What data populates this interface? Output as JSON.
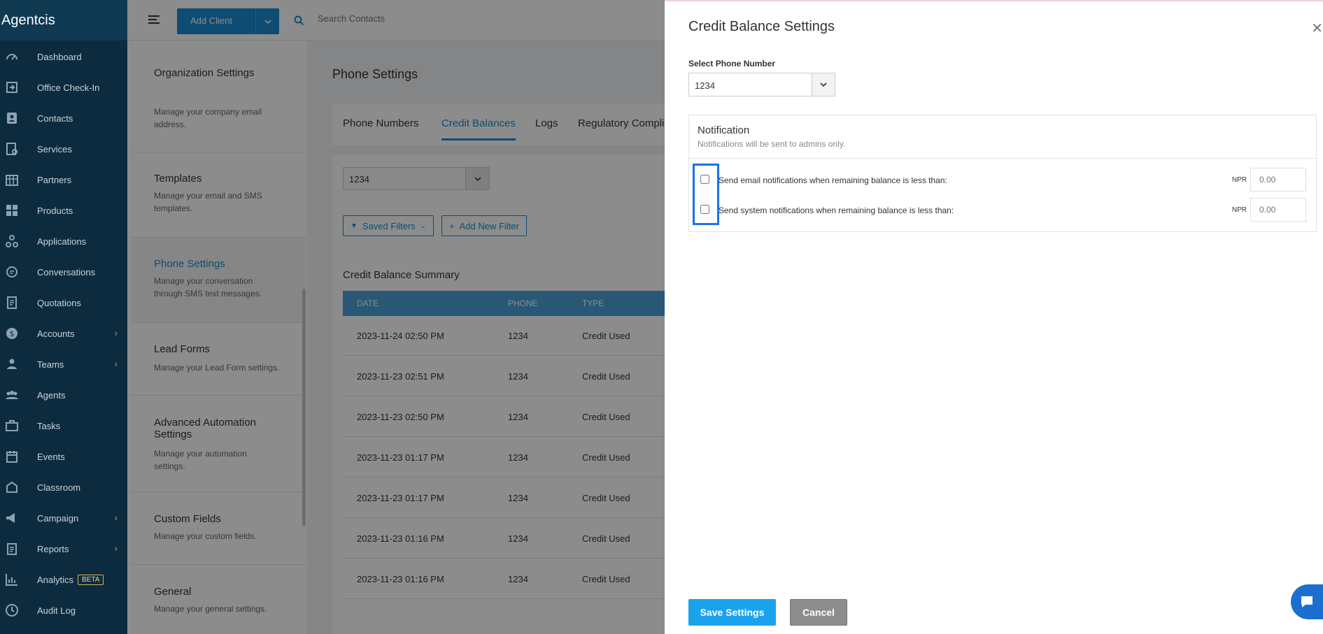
{
  "sidebar": {
    "brand": "Agentcis",
    "items": [
      {
        "label": "Dashboard",
        "icon": "dashboard-icon",
        "chevron": false
      },
      {
        "label": "Office Check-In",
        "icon": "check-in-icon",
        "chevron": false
      },
      {
        "label": "Contacts",
        "icon": "contacts-icon",
        "chevron": false
      },
      {
        "label": "Services",
        "icon": "services-icon",
        "chevron": false
      },
      {
        "label": "Partners",
        "icon": "partners-icon",
        "chevron": false
      },
      {
        "label": "Products",
        "icon": "products-icon",
        "chevron": false
      },
      {
        "label": "Applications",
        "icon": "applications-icon",
        "chevron": false
      },
      {
        "label": "Conversations",
        "icon": "conversations-icon",
        "chevron": false
      },
      {
        "label": "Quotations",
        "icon": "quotations-icon",
        "chevron": false
      },
      {
        "label": "Accounts",
        "icon": "accounts-icon",
        "chevron": true
      },
      {
        "label": "Teams",
        "icon": "teams-icon",
        "chevron": true
      },
      {
        "label": "Agents",
        "icon": "agents-icon",
        "chevron": false
      },
      {
        "label": "Tasks",
        "icon": "tasks-icon",
        "chevron": false
      },
      {
        "label": "Events",
        "icon": "events-icon",
        "chevron": false
      },
      {
        "label": "Classroom",
        "icon": "classroom-icon",
        "chevron": false
      },
      {
        "label": "Campaign",
        "icon": "campaign-icon",
        "chevron": true
      },
      {
        "label": "Reports",
        "icon": "reports-icon",
        "chevron": true
      },
      {
        "label": "Analytics",
        "icon": "analytics-icon",
        "chevron": false,
        "badge": "BETA"
      },
      {
        "label": "Audit Log",
        "icon": "audit-log-icon",
        "chevron": false
      }
    ]
  },
  "topbar": {
    "add_client_label": "Add Client",
    "search_placeholder": "Search Contacts"
  },
  "settings_list": {
    "items": [
      {
        "title": "Organization Settings",
        "desc": "Manage your company email address."
      },
      {
        "title": "Templates",
        "desc": "Manage your email and SMS templates."
      },
      {
        "title": "Phone Settings",
        "desc": "Manage your conversation through SMS text messages."
      },
      {
        "title": "Lead Forms",
        "desc": "Manage your Lead Form settings."
      },
      {
        "title": "Advanced Automation Settings",
        "desc": "Manage your automation settings."
      },
      {
        "title": "Custom Fields",
        "desc": "Manage your custom fields."
      },
      {
        "title": "General",
        "desc": "Manage your general settings."
      }
    ]
  },
  "main": {
    "title": "Phone Settings",
    "tabs": [
      "Phone Numbers",
      "Credit Balances",
      "Logs",
      "Regulatory Compli"
    ],
    "phone_select_value": "1234",
    "saved_filters_label": "Saved Filters",
    "add_filter_label": "Add New Filter",
    "summary_title": "Credit Balance Summary",
    "table": {
      "columns": [
        "DATE",
        "PHONE",
        "TYPE"
      ],
      "rows": [
        [
          "2023-11-24 02:50 PM",
          "1234",
          "Credit Used"
        ],
        [
          "2023-11-23 02:51 PM",
          "1234",
          "Credit Used"
        ],
        [
          "2023-11-23 02:50 PM",
          "1234",
          "Credit Used"
        ],
        [
          "2023-11-23 01:17 PM",
          "1234",
          "Credit Used"
        ],
        [
          "2023-11-23 01:17 PM",
          "1234",
          "Credit Used"
        ],
        [
          "2023-11-23 01:16 PM",
          "1234",
          "Credit Used"
        ],
        [
          "2023-11-23 01:16 PM",
          "1234",
          "Credit Used"
        ]
      ]
    }
  },
  "drawer": {
    "title": "Credit Balance Settings",
    "select_label": "Select Phone Number",
    "select_value": "1234",
    "notification_title": "Notification",
    "notification_subtitle": "Notifications will be sent to admins only.",
    "rows": [
      {
        "text": "Send email notifications when remaining balance is less than:",
        "currency": "NPR",
        "placeholder": "0.00"
      },
      {
        "text": "Send system notifications when remaining balance is less than:",
        "currency": "NPR",
        "placeholder": "0.00"
      }
    ],
    "save_label": "Save Settings",
    "cancel_label": "Cancel"
  },
  "colors": {
    "sidebar_bg": "#0d2b3e",
    "accent": "#1c8ad1",
    "save_button": "#1aa3ec",
    "cancel_button": "#8d8d8d",
    "highlight": "#1a73e8"
  }
}
